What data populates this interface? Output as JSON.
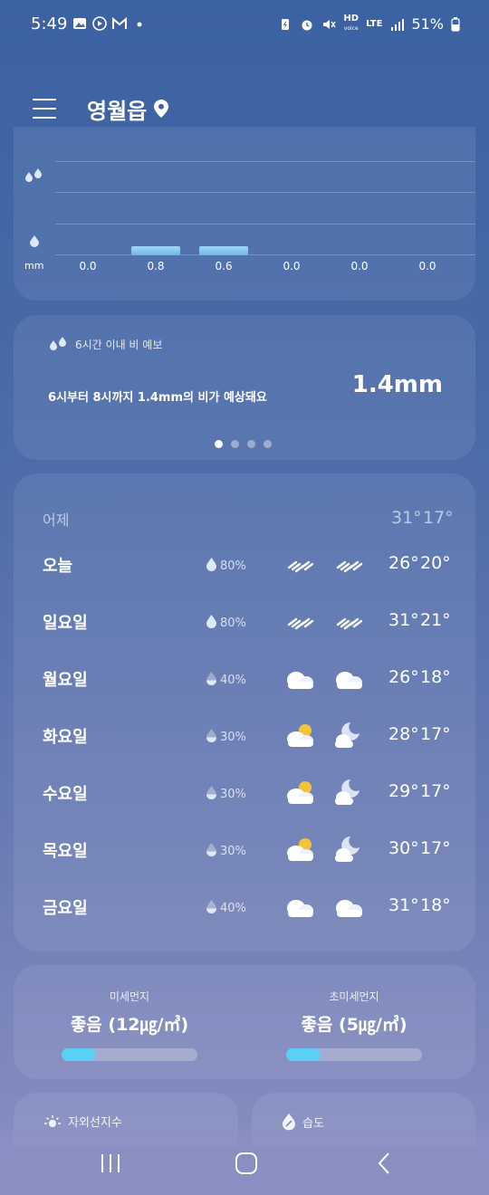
{
  "status_bar": {
    "time": "5:49",
    "battery": "51%",
    "network": "LTE",
    "hd_label": "HD"
  },
  "header": {
    "location": "영월읍"
  },
  "rain_chart": {
    "unit": "mm",
    "values": [
      "0.0",
      "0.8",
      "0.6",
      "0.0",
      "0.0",
      "0.0"
    ]
  },
  "rain_forecast": {
    "title": "6시간 이내 비 예보",
    "message": "6시부터 8시까지 1.4mm의 비가 예상돼요",
    "amount": "1.4mm",
    "pages": 4,
    "active_page": 1
  },
  "weekly": {
    "yesterday": {
      "day": "어제",
      "high": "31°",
      "low": "17°"
    },
    "days": [
      {
        "day": "오늘",
        "pop": "80%",
        "am": "rain-icon",
        "pm": "rain-icon",
        "high": "26°",
        "low": "20°"
      },
      {
        "day": "일요일",
        "pop": "80%",
        "am": "rain-icon",
        "pm": "rain-icon",
        "high": "31°",
        "low": "21°"
      },
      {
        "day": "월요일",
        "pop": "40%",
        "am": "cloud-icon",
        "pm": "cloud-icon",
        "high": "26°",
        "low": "18°"
      },
      {
        "day": "화요일",
        "pop": "30%",
        "am": "partly-cloudy-day-icon",
        "pm": "partly-cloudy-night-icon",
        "high": "28°",
        "low": "17°"
      },
      {
        "day": "수요일",
        "pop": "30%",
        "am": "partly-cloudy-day-icon",
        "pm": "partly-cloudy-night-icon",
        "high": "29°",
        "low": "17°"
      },
      {
        "day": "목요일",
        "pop": "30%",
        "am": "partly-cloudy-day-icon",
        "pm": "partly-cloudy-night-icon",
        "high": "30°",
        "low": "17°"
      },
      {
        "day": "금요일",
        "pop": "40%",
        "am": "cloud-icon",
        "pm": "cloud-icon",
        "high": "31°",
        "low": "18°"
      }
    ]
  },
  "dust": {
    "fine": {
      "label": "미세먼지",
      "value": "좋음 (12㎍/㎥)",
      "level": 0.25
    },
    "ultrafine": {
      "label": "초미세먼지",
      "value": "좋음 (5㎍/㎥)",
      "level": 0.25
    },
    "accent_color": "#5bd0f5"
  },
  "tiles": {
    "uv_label": "자외선지수",
    "humidity_label": "습도"
  }
}
